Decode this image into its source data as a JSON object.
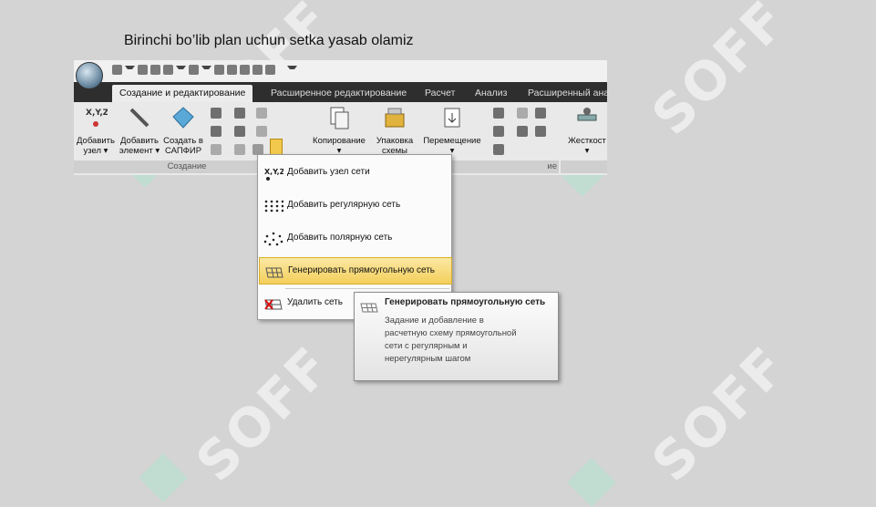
{
  "slide": {
    "title": "Birinchi bo’lib plan uchun setka yasab olamiz"
  },
  "watermark": {
    "text": "SOFF",
    "color": "#ffffff"
  },
  "app": {
    "tabs": [
      "Создание и редактирование",
      "Расширенное редактирование",
      "Расчет",
      "Анализ",
      "Расширенный ана"
    ],
    "active_tab": 0,
    "ribbon": {
      "buttons": [
        {
          "label1": "Добавить",
          "label2": "узел ▾",
          "icon": "xyz-node-icon"
        },
        {
          "label1": "Добавить",
          "label2": "элемент ▾",
          "icon": "beam-element-icon"
        },
        {
          "label1": "Создать в",
          "label2": "САПФИР",
          "icon": "sapfir-icon"
        },
        {
          "label1": "Копирование",
          "label2": "▾",
          "icon": "copy-icon"
        },
        {
          "label1": "Упаковка",
          "label2": "схемы",
          "icon": "pack-icon"
        },
        {
          "label1": "Перемещение",
          "label2": "▾",
          "icon": "move-icon"
        },
        {
          "label1": "Жесткост",
          "label2": "▾",
          "icon": "stiffness-icon"
        }
      ],
      "group_labels": [
        "Создание",
        "ие"
      ]
    }
  },
  "menu": {
    "items": [
      {
        "label": "Добавить узел сети",
        "icon": "xyz-icon"
      },
      {
        "label": "Добавить регулярную сеть",
        "icon": "regular-grid-icon"
      },
      {
        "label": "Добавить полярную сеть",
        "icon": "polar-grid-icon"
      },
      {
        "label": "Генерировать прямоугольную сеть",
        "icon": "rect-grid-icon",
        "highlighted": true
      },
      {
        "label": "Удалить сеть",
        "icon": "delete-grid-icon"
      }
    ]
  },
  "tooltip": {
    "title": "Генерировать прямоугольную сеть",
    "body": "Задание и добавление в расчетную схему прямоугольной сети с регулярным и нерегулярным шагом"
  },
  "colors": {
    "accent": "#f3cf5b",
    "tab_bar": "#2e2e2e",
    "ribbon": "#e9e9e9"
  }
}
